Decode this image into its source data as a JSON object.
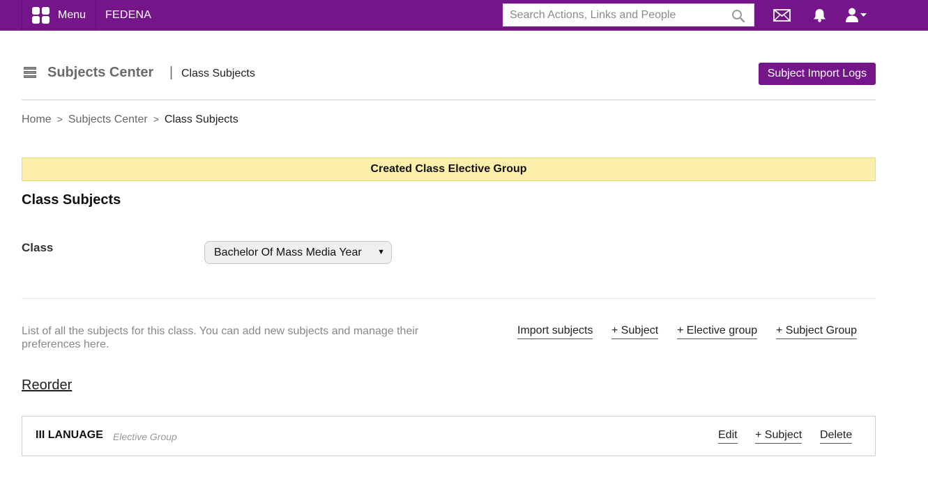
{
  "topbar": {
    "menu_label": "Menu",
    "brand": "FEDENA",
    "search_placeholder": "Search Actions, Links and People",
    "icons": [
      "grid-icon",
      "search-icon",
      "mail-icon",
      "bell-icon",
      "user-icon",
      "caret-down-icon"
    ],
    "color": "#74168a"
  },
  "header": {
    "title": "Subjects Center",
    "separator": "|",
    "subtitle": "Class Subjects",
    "import_logs_button": "Subject Import Logs"
  },
  "breadcrumb": {
    "items": [
      "Home",
      "Subjects Center",
      "Class Subjects"
    ],
    "separator": ">"
  },
  "flash": {
    "message": "Created Class Elective Group",
    "color": "#fcefaa"
  },
  "main": {
    "section_title": "Class Subjects",
    "class_label": "Class",
    "class_selected": "Bachelor Of Mass Media Year",
    "description": "List of all the subjects for this class. You can add new subjects and manage their preferences here.",
    "actions": {
      "import": "Import subjects",
      "add_subject": "+ Subject",
      "add_elective": "+ Elective group",
      "add_subject_group": "+ Subject Group"
    },
    "reorder_label": "Reorder"
  },
  "groups": [
    {
      "name": "III LANUAGE",
      "type": "Elective Group",
      "actions": {
        "edit": "Edit",
        "add_subject": "+ Subject",
        "delete": "Delete"
      }
    }
  ]
}
